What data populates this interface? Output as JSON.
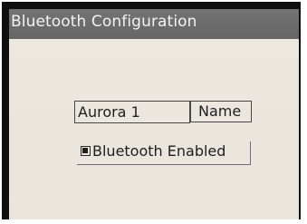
{
  "window": {
    "title": "Bluetooth Configuration"
  },
  "device": {
    "name_value": "Aurora 1",
    "name_label": "Name"
  },
  "bluetooth": {
    "label": "Bluetooth Enabled",
    "enabled": true
  },
  "colors": {
    "title_bar": "#6e6e6e",
    "title_text": "#f2f2f2",
    "background": "#ebe7df",
    "bezel": "#0f0f0f"
  }
}
